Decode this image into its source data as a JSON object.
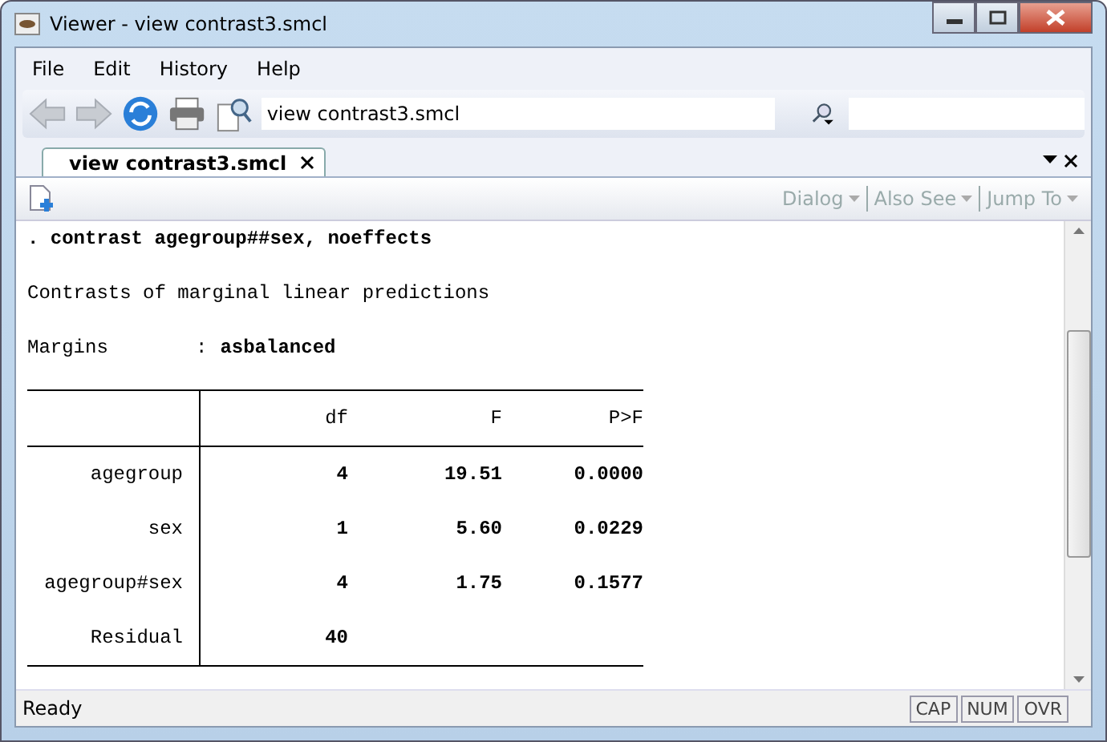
{
  "window": {
    "title": "Viewer - view contrast3.smcl"
  },
  "menu": [
    "File",
    "Edit",
    "History",
    "Help"
  ],
  "toolbar": {
    "address": "view contrast3.smcl"
  },
  "tabs": [
    {
      "label": "view contrast3.smcl",
      "selected": true
    }
  ],
  "viewer_menus": [
    {
      "label": "Dialog",
      "disabled": true
    },
    {
      "label": "Also See",
      "disabled": true
    },
    {
      "label": "Jump To",
      "disabled": true
    }
  ],
  "output": {
    "command": ". contrast agegroup##sex, noeffects",
    "heading": "Contrasts of marginal linear predictions",
    "margins_label": "Margins",
    "margins_sep": ":",
    "margins_value": "asbalanced",
    "table": {
      "columns": [
        "df",
        "F",
        "P>F"
      ],
      "rows": [
        {
          "label": "agegroup",
          "cells": [
            "4",
            "19.51",
            "0.0000"
          ]
        },
        {
          "label": "sex",
          "cells": [
            "1",
            "5.60",
            "0.0229"
          ]
        },
        {
          "label": "agegroup#sex",
          "cells": [
            "4",
            "1.75",
            "0.1577"
          ]
        },
        {
          "label": "Residual",
          "cells": [
            "40"
          ]
        }
      ]
    }
  },
  "status_bar": {
    "text": "Ready",
    "indicators": [
      "CAP",
      "NUM",
      "OVR"
    ]
  }
}
